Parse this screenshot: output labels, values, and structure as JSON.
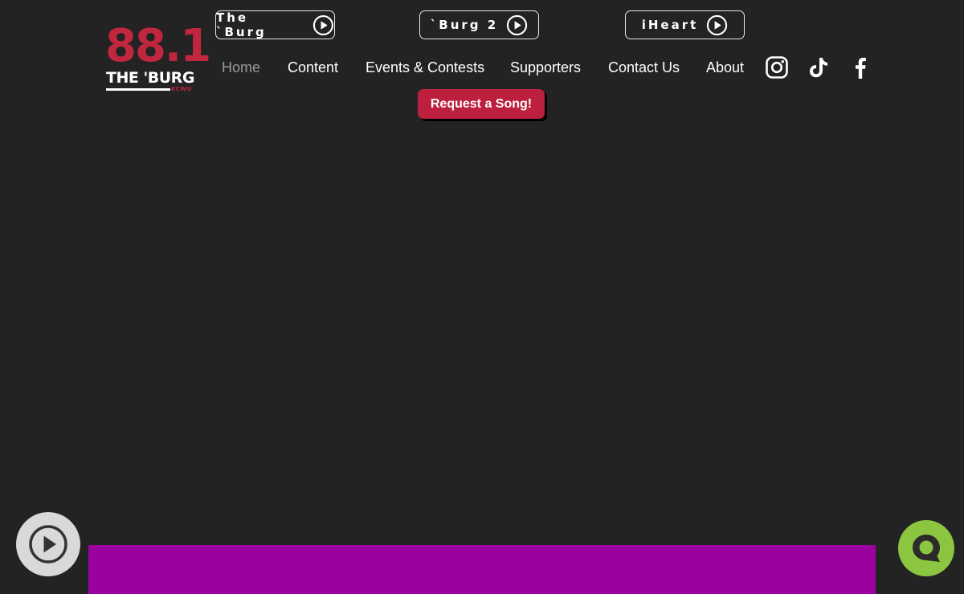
{
  "logo": {
    "number": "88.1",
    "name": "THE 'BURG",
    "call_sign": "KCWU",
    "colors": {
      "red": "#c0273f",
      "white": "#ffffff"
    }
  },
  "streams": [
    {
      "label": "The `Burg",
      "icon": "play-circle-icon"
    },
    {
      "label": "`Burg 2",
      "icon": "play-circle-icon"
    },
    {
      "label": "iHeart",
      "icon": "play-circle-icon"
    }
  ],
  "nav": {
    "items": [
      {
        "label": "Home",
        "active": true
      },
      {
        "label": "Content",
        "active": false
      },
      {
        "label": "Events & Contests",
        "active": false
      },
      {
        "label": "Supporters",
        "active": false
      },
      {
        "label": "Contact Us",
        "active": false
      },
      {
        "label": "About",
        "active": false
      }
    ]
  },
  "social": [
    {
      "name": "instagram-icon"
    },
    {
      "name": "tiktok-icon"
    },
    {
      "name": "facebook-icon"
    }
  ],
  "request_button": {
    "label": "Request a Song!",
    "color": "#bd1f3e"
  },
  "player": {
    "icon": "play-circle-icon",
    "background": "#d9d9d9"
  },
  "chat": {
    "icon": "chat-bubble-icon",
    "background": "#8cc540"
  },
  "colors": {
    "background": "#232323",
    "purple_bar": "#9b019e",
    "nav_active": "#9a9a9a",
    "nav_text": "#ffffff"
  }
}
